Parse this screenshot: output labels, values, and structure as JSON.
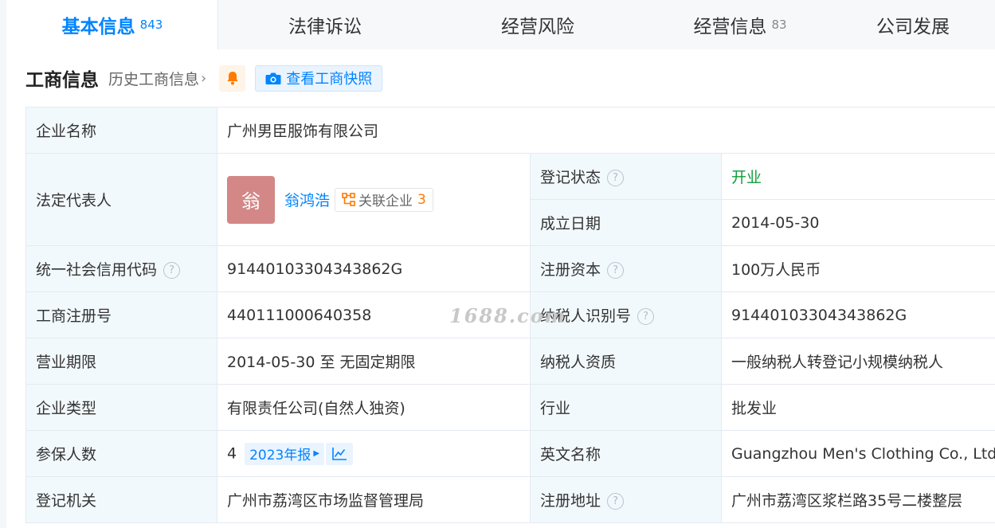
{
  "tabs": [
    {
      "label": "基本信息",
      "count": "843",
      "active": true
    },
    {
      "label": "法律诉讼",
      "count": ""
    },
    {
      "label": "经营风险",
      "count": ""
    },
    {
      "label": "经营信息",
      "count": "83"
    },
    {
      "label": "公司发展",
      "count": ""
    }
  ],
  "section": {
    "title": "工商信息",
    "history_link": "历史工商信息",
    "snapshot_button": "查看工商快照"
  },
  "company": {
    "name_label": "企业名称",
    "name": "广州男臣服饰有限公司",
    "legal_rep_label": "法定代表人",
    "avatar_char": "翁",
    "legal_rep": "翁鸿浩",
    "related_label": "关联企业",
    "related_count": "3",
    "status_label": "登记状态",
    "status": "开业",
    "founded_label": "成立日期",
    "founded": "2014-05-30",
    "credit_code_label": "统一社会信用代码",
    "credit_code": "91440103304343862G",
    "capital_label": "注册资本",
    "capital": "100万人民币",
    "reg_no_label": "工商注册号",
    "reg_no": "440111000640358",
    "taxpayer_id_label": "纳税人识别号",
    "taxpayer_id": "91440103304343862G",
    "term_label": "营业期限",
    "term": "2014-05-30 至 无固定期限",
    "taxpayer_type_label": "纳税人资质",
    "taxpayer_type": "一般纳税人转登记小规模纳税人",
    "type_label": "企业类型",
    "type": "有限责任公司(自然人独资)",
    "industry_label": "行业",
    "industry": "批发业",
    "insured_label": "参保人数",
    "insured": "4",
    "insured_report": "2023年报",
    "english_name_label": "英文名称",
    "english_name": "Guangzhou Men's Clothing Co., Ltd.",
    "authority_label": "登记机关",
    "authority": "广州市荔湾区市场监督管理局",
    "address_label": "注册地址",
    "address": "广州市荔湾区浆栏路35号二楼整层"
  },
  "watermark": "1688.com",
  "colors": {
    "accent": "#0084ff",
    "status_green": "#0f9d3a",
    "label_bg": "#f2f9fc",
    "avatar_bg": "#d38787",
    "related_count": "#ff7a00"
  }
}
